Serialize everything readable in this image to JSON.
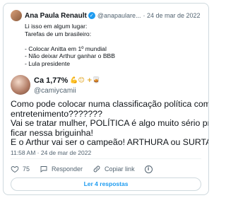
{
  "quoted": {
    "name": "Ana Paula Renault",
    "handle": "@anapaulare...",
    "date": "· 24 de mar de 2022",
    "lines": [
      "Li isso em algum lugar:",
      "Tarefas de um brasileiro:",
      "",
      "- Colocar Anitta em 1º mundial",
      "- Não deixar Arthur ganhar o BBB",
      "- Lula presidente"
    ]
  },
  "tweet": {
    "name": "Ca 1,77%",
    "emoji": "💪😊 +🥃",
    "handle": "@camiycamii",
    "lines": [
      "Como pode colocar numa classificação política com",
      "entretenimento???????",
      "Vai se tratar mulher, POLÍTICA é algo muito sério pra",
      "ficar nessa briguinha!",
      "E o Arthur vai ser o campeão! ARTHURA ou SURTA"
    ],
    "timestamp": "11:58 AM · 24 de mar de 2022"
  },
  "actions": {
    "likes": "75",
    "reply_label": "Responder",
    "copy_label": "Copiar link",
    "info": "i"
  },
  "footer": {
    "replies_button": "Ler 4 respostas"
  },
  "colors": {
    "accent": "#1d9bf0",
    "muted": "#536471",
    "border": "#cfd9de"
  }
}
